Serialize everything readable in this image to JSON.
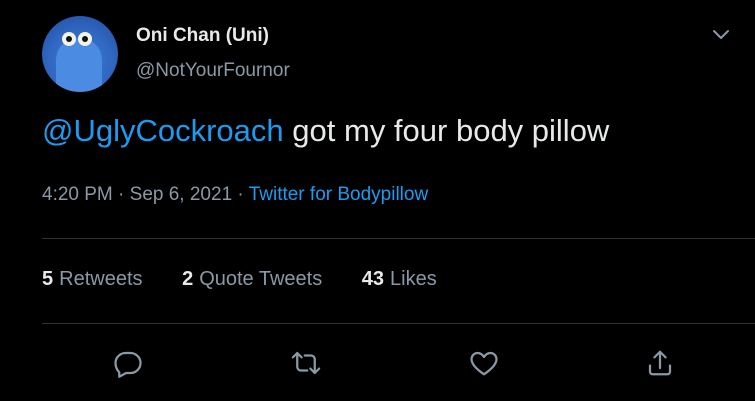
{
  "user": {
    "display_name": "Oni Chan (Uni)",
    "handle": "@NotYourFournor",
    "avatar_icon": "avatar-image"
  },
  "tweet": {
    "mention": "@UglyCockroach",
    "text": " got my four body pillow",
    "time": "4:20 PM",
    "separator1": " · ",
    "date": "Sep 6, 2021",
    "separator2": " · ",
    "source": "Twitter for Bodypillow"
  },
  "stats": {
    "retweets_count": "5",
    "retweets_label": "Retweets",
    "quotes_count": "2",
    "quotes_label": "Quote Tweets",
    "likes_count": "43",
    "likes_label": "Likes"
  },
  "colors": {
    "background": "#000000",
    "accent": "#1d9bf0",
    "text_primary": "#e7e9ea",
    "text_secondary": "#8b98a5",
    "divider": "#2f3336"
  },
  "icons": {
    "more": "chevron-down-icon",
    "reply": "reply-icon",
    "retweet": "retweet-icon",
    "like": "heart-icon",
    "share": "share-icon"
  }
}
